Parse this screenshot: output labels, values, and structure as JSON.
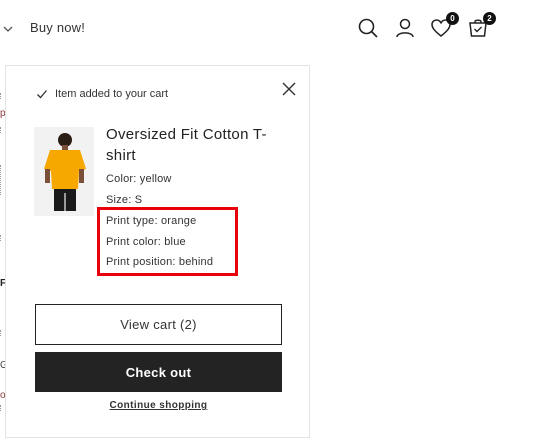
{
  "header": {
    "nav_link": "Buy now!",
    "wishlist_count": "0",
    "cart_count": "2",
    "icons": [
      "chevron-down-icon",
      "search-icon",
      "account-icon",
      "heart-icon",
      "cart-icon"
    ]
  },
  "background": {
    "fragments": [
      "p",
      "F",
      "G",
      "ol"
    ]
  },
  "cart_popup": {
    "added_message": "Item added to your cart",
    "product": {
      "name": "Oversized Fit Cotton T-shirt",
      "options": [
        "Color: yellow",
        "Size: S",
        "Print type: orange",
        "Print color: blue",
        "Print position: behind"
      ]
    },
    "view_cart_label": "View cart (2)",
    "checkout_label": "Check out",
    "continue_label": "Continue shopping"
  },
  "colors": {
    "highlight": "#e8000b",
    "checkout_bg": "#232323",
    "shirt": "#f6a800"
  }
}
